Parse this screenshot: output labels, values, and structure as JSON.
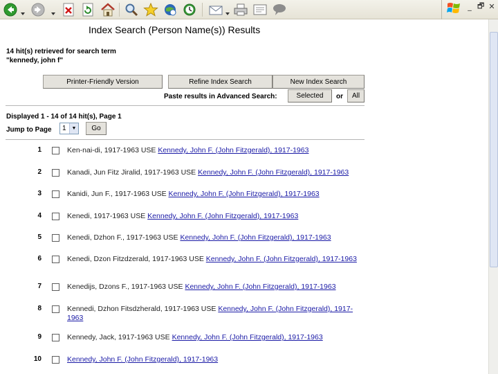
{
  "toolbar": {
    "buttons": [
      "back-icon",
      "forward-icon",
      "stop-icon",
      "refresh-icon",
      "home-icon",
      "search-icon",
      "favorites-icon",
      "media-icon",
      "history-icon",
      "mail-icon",
      "print-icon",
      "edit-icon",
      "discuss-icon"
    ],
    "window_controls": [
      "_",
      "🗗",
      "✕"
    ]
  },
  "page": {
    "title": "Index Search (Person Name(s)) Results",
    "hits_line1": "14  hit(s) retrieved for search term",
    "hits_line2": "\"kennedy, john f\""
  },
  "buttons": {
    "printer_friendly": "Printer-Friendly Version",
    "refine": "Refine Index Search",
    "new_search": "New Index Search",
    "selected": "Selected",
    "all": "All"
  },
  "paste": {
    "label": "Paste results in Advanced Search:",
    "or": "or"
  },
  "pagination": {
    "displayed": "Displayed 1 -  14 of 14 hit(s), Page 1",
    "jump_label": "Jump to Page",
    "page_value": "1",
    "go": "Go"
  },
  "results": [
    {
      "num": "1",
      "pre": "Ken-nai-di, 1917-1963 USE ",
      "link": "Kennedy, John F. (John Fitzgerald), 1917-1963"
    },
    {
      "num": "2",
      "pre": "Kanadi, Jun Fitz Jiralid, 1917-1963 USE ",
      "link": "Kennedy, John F. (John Fitzgerald), 1917-1963"
    },
    {
      "num": "3",
      "pre": "Kanidi, Jun F., 1917-1963 USE ",
      "link": "Kennedy, John F. (John Fitzgerald), 1917-1963"
    },
    {
      "num": "4",
      "pre": "Kenedi, 1917-1963 USE ",
      "link": "Kennedy, John F. (John Fitzgerald), 1917-1963"
    },
    {
      "num": "5",
      "pre": "Kenedi, Dzhon F., 1917-1963 USE ",
      "link": "Kennedy, John F. (John Fitzgerald), 1917-1963"
    },
    {
      "num": "6",
      "pre": "Kenedi, Dzon Fitzdzerald, 1917-1963 USE ",
      "link": "Kennedy, John F. (John Fitzgerald), 1917-1963"
    },
    {
      "num": "7",
      "pre": "Kenedijs, Dzons F., 1917-1963 USE ",
      "link": "Kennedy, John F. (John Fitzgerald), 1917-1963"
    },
    {
      "num": "8",
      "pre": "Kennedi, Dzhon Fitsdzherald, 1917-1963 USE ",
      "link": "Kennedy, John F. (John Fitzgerald), 1917-1963"
    },
    {
      "num": "9",
      "pre": "Kennedy, Jack, 1917-1963 USE ",
      "link": "Kennedy, John F. (John Fitzgerald), 1917-1963"
    },
    {
      "num": "10",
      "pre": "",
      "link": "Kennedy, John F. (John Fitzgerald), 1917-1963"
    }
  ]
}
